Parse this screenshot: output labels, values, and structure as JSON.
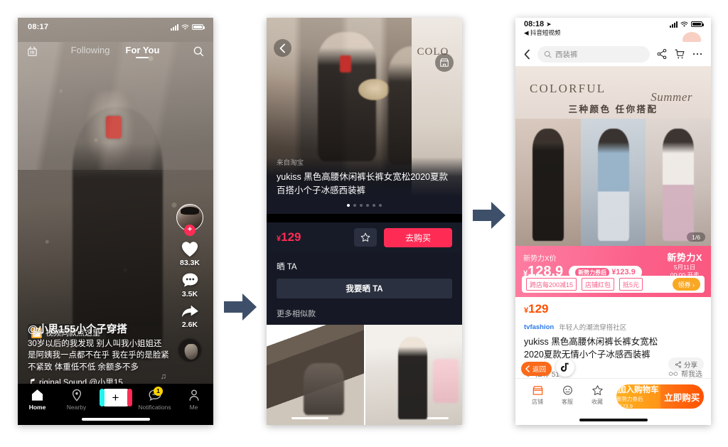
{
  "phone1": {
    "status": {
      "time": "08:17"
    },
    "topbar": {
      "live_icon": "live-icon",
      "tabs": [
        {
          "label": "Following",
          "active": false
        },
        {
          "label": "For You",
          "active": true
        }
      ],
      "search_icon": "search-icon"
    },
    "rail": {
      "avatar_icon": "avatar",
      "follow_label": "+",
      "like_count": "83.3K",
      "comment_count": "3.5K",
      "share_count": "2.6K",
      "music_disc_icon": "music-disc-icon"
    },
    "shop_tag": {
      "label": "视频同款点这里",
      "icon": "shopping-bag-icon"
    },
    "caption": {
      "user": "@小思155小个子穿搭",
      "text": "30岁以后的我发现 别人叫我小姐姐还是阿姨我一点都不在乎 我在乎的是脸紧不紧致 体重低不低 余额多不多",
      "music": "riginal Sound    @小思15",
      "music_icon": "music-note-icon"
    },
    "tabbar": {
      "items": [
        {
          "label": "Home",
          "icon": "home-icon",
          "active": true
        },
        {
          "label": "Nearby",
          "icon": "location-pin-icon",
          "active": false
        },
        {
          "label": "",
          "icon": "plus-icon",
          "active": false
        },
        {
          "label": "Notifications",
          "icon": "chat-bubble-icon",
          "active": false,
          "badge": "1"
        },
        {
          "label": "Me",
          "icon": "person-icon",
          "active": false
        }
      ]
    }
  },
  "phone2": {
    "back_icon": "chevron-left-icon",
    "shop_icon": "storefront-icon",
    "side_card_text": "COLO",
    "info": {
      "source": "来自淘宝",
      "title": "yukiss 黑色高腰休闲裤长裤女宽松2020夏款百搭小个子冰感西装裤",
      "dots_total": 6,
      "dots_active": 0
    },
    "buyrow": {
      "currency": "¥",
      "price": "129",
      "star_icon": "star-icon",
      "buy_label": "去购买"
    },
    "shai": {
      "label": "晒 TA",
      "button_label": "我要晒 TA"
    },
    "more": {
      "label": "更多相似款"
    }
  },
  "phone3": {
    "status": {
      "time": "08:18",
      "location_icon": "location-arrow-icon",
      "back_app": "◀ 抖音短视频"
    },
    "nav": {
      "back_icon": "chevron-left-icon",
      "search_icon": "search-icon",
      "search_value": "西装裤",
      "share_icon": "share-icon",
      "cart_icon": "cart-icon",
      "more_icon": "more-dots-icon"
    },
    "hero": {
      "headline": "COLORFUL",
      "script": "Summer",
      "subhead": "三种颜色 任你搭配",
      "counter": "1/6"
    },
    "promo": {
      "label": "新势力X价",
      "currency": "¥",
      "price": "128.9",
      "coupon_tag": "新势力券后",
      "coupon_price": "¥123.9",
      "brand_name": "新势力X",
      "brand_date": "5月11日",
      "brand_time": "00:00 开卖",
      "coupons": [
        "跨店每200减15",
        "店铺红包",
        "抵5元"
      ],
      "get_coupon": "领券 ›"
    },
    "price": {
      "currency": "¥",
      "value": "129"
    },
    "shop": {
      "name": "tvfashion",
      "desc": "年轻人的潮流穿搭社区"
    },
    "title": "yukiss 黑色高腰休闲裤长裤女宽松2020夏款无情小个子冰感西装裤",
    "share_pill": {
      "label": "分享",
      "icon": "share-icon"
    },
    "meta": {
      "like_icon": "heart-icon",
      "recommend_label": "推荐 51",
      "help_icon": "glasses-icon",
      "help_label": "帮我选"
    },
    "back_pill": {
      "label": "返回",
      "icon": "chevron-left-icon"
    },
    "tiktok_badge_icon": "tiktok-icon",
    "bottom": {
      "items": [
        {
          "label": "店铺",
          "icon": "storefront-icon"
        },
        {
          "label": "客服",
          "icon": "service-face-icon"
        },
        {
          "label": "收藏",
          "icon": "star-icon"
        }
      ],
      "cart_label": "加入购物车",
      "cart_sub": "新势力券后 ¥123.9",
      "buy_label": "立即购买"
    }
  },
  "arrows": {
    "arrow1": "right-arrow-icon",
    "arrow2": "right-arrow-icon",
    "color": "#3E5069"
  }
}
